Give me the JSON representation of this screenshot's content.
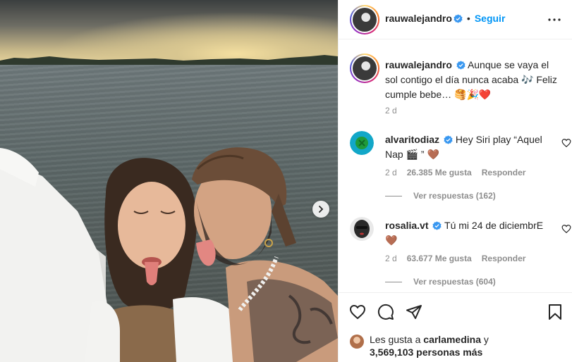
{
  "post": {
    "author": "rauwalejandro",
    "follow_label": "Seguir",
    "dot": "•",
    "caption": "Aunque se vaya el sol contigo el día nunca acaba 🎶 Feliz cumple bebe… 🥞🎉❤️",
    "time": "2 d"
  },
  "comments": [
    {
      "user": "alvaritodiaz",
      "text": "Hey Siri play “Aquel Nap 🎬 ” 🤎",
      "time": "2 d",
      "likes": "26.385 Me gusta",
      "reply_label": "Responder",
      "view_replies": "Ver respuestas (162)"
    },
    {
      "user": "rosalia.vt",
      "text": "Tú mi 24 de diciembrE 🤎",
      "time": "2 d",
      "likes": "63.677 Me gusta",
      "reply_label": "Responder",
      "view_replies": "Ver respuestas (604)"
    }
  ],
  "likes_line": {
    "prefix": "Les gusta a ",
    "user": "carlamedina",
    "middle": " y",
    "count": "3,569,103 personas más"
  },
  "icons": {
    "verified": "verified-badge-icon",
    "more": "more-options-icon",
    "next": "chevron-right-icon",
    "like": "heart-icon",
    "comment": "comment-bubble-icon",
    "share": "paper-plane-icon",
    "save": "bookmark-icon"
  },
  "colors": {
    "accent": "#0095f6",
    "verified": "#3897f0",
    "text": "#262626",
    "muted": "#8e8e8e"
  }
}
